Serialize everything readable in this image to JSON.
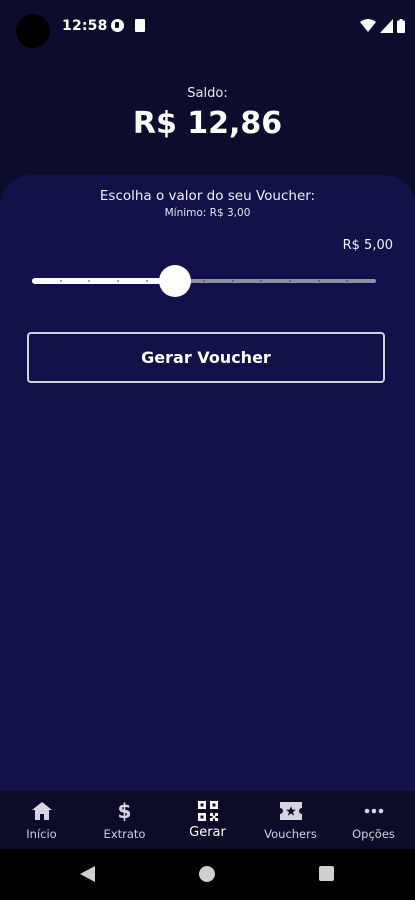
{
  "status_bar": {
    "time": "12:58"
  },
  "balance": {
    "label": "Saldo:",
    "value": "R$ 12,86"
  },
  "voucher": {
    "choose_label": "Escolha o valor do seu Voucher:",
    "minimum_label": "Mínimo: R$ 3,00",
    "selected_value": "R$ 5,00",
    "slider_position_fraction": 0.417,
    "slider_steps": 12,
    "generate_label": "Gerar Voucher"
  },
  "bottom_nav": {
    "items": [
      {
        "label": "Início",
        "icon": "home-icon"
      },
      {
        "label": "Extrato",
        "icon": "dollar-icon"
      },
      {
        "label": "Gerar",
        "icon": "qr-code-icon",
        "active": true
      },
      {
        "label": "Vouchers",
        "icon": "ticket-icon"
      },
      {
        "label": "Opções",
        "icon": "more-dots-icon"
      }
    ]
  },
  "colors": {
    "background": "#0c0c2c",
    "card": "#121149",
    "accent": "#ffffff"
  }
}
